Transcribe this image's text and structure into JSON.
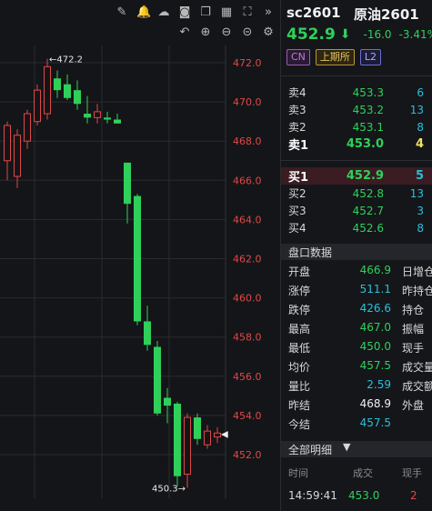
{
  "toolbar": {
    "row1": [
      {
        "name": "draw-pen-icon",
        "glyph": "✎"
      },
      {
        "name": "alert-bell-icon",
        "glyph": "🔔"
      },
      {
        "name": "cloud-icon",
        "glyph": "☁"
      },
      {
        "name": "camera-icon",
        "glyph": "◙"
      },
      {
        "name": "window-icon",
        "glyph": "❐"
      },
      {
        "name": "layout-icon",
        "glyph": "▦"
      },
      {
        "name": "fullscreen-icon",
        "glyph": "⛶"
      },
      {
        "name": "collapse-icon",
        "glyph": "»"
      }
    ],
    "row2": [
      {
        "name": "undo-icon",
        "glyph": "↶"
      },
      {
        "name": "zoom-in-icon",
        "glyph": "⊕"
      },
      {
        "name": "zoom-out-icon",
        "glyph": "⊖"
      },
      {
        "name": "reset-icon",
        "glyph": "⊝"
      },
      {
        "name": "settings-gear-icon",
        "glyph": "⚙"
      }
    ]
  },
  "chart_data": {
    "type": "candlestick",
    "y_ticks": [
      "472.0",
      "470.0",
      "468.0",
      "466.0",
      "464.0",
      "462.0",
      "460.0",
      "458.0",
      "456.0",
      "454.0",
      "452.0"
    ],
    "ylim": [
      451.0,
      472.5
    ],
    "high_label": "←472.2",
    "low_label": "450.3→",
    "current_marker": "◀",
    "candles": [
      {
        "o": 467.0,
        "h": 469.0,
        "l": 466.0,
        "c": 468.8
      },
      {
        "o": 466.2,
        "h": 468.6,
        "l": 465.6,
        "c": 468.3
      },
      {
        "o": 468.0,
        "h": 469.6,
        "l": 467.6,
        "c": 469.4
      },
      {
        "o": 469.0,
        "h": 470.9,
        "l": 468.8,
        "c": 470.6
      },
      {
        "o": 469.4,
        "h": 472.2,
        "l": 469.1,
        "c": 471.8
      },
      {
        "o": 471.2,
        "h": 471.6,
        "l": 470.2,
        "c": 470.6
      },
      {
        "o": 470.9,
        "h": 471.4,
        "l": 470.1,
        "c": 470.2
      },
      {
        "o": 470.6,
        "h": 471.1,
        "l": 469.6,
        "c": 469.9
      },
      {
        "o": 469.4,
        "h": 470.3,
        "l": 468.9,
        "c": 469.2
      },
      {
        "o": 469.2,
        "h": 469.9,
        "l": 468.9,
        "c": 469.5
      },
      {
        "o": 469.2,
        "h": 469.5,
        "l": 468.9,
        "c": 469.1
      },
      {
        "o": 469.1,
        "h": 469.4,
        "l": 468.9,
        "c": 468.9
      },
      {
        "o": 466.9,
        "h": 466.9,
        "l": 463.8,
        "c": 464.8
      },
      {
        "o": 465.2,
        "h": 465.3,
        "l": 458.6,
        "c": 458.8
      },
      {
        "o": 458.8,
        "h": 459.6,
        "l": 457.3,
        "c": 457.6
      },
      {
        "o": 457.5,
        "h": 457.8,
        "l": 454.0,
        "c": 454.1
      },
      {
        "o": 454.9,
        "h": 455.4,
        "l": 453.6,
        "c": 454.5
      },
      {
        "o": 454.6,
        "h": 454.7,
        "l": 450.4,
        "c": 450.9
      },
      {
        "o": 451.0,
        "h": 454.1,
        "l": 450.3,
        "c": 453.9
      },
      {
        "o": 453.9,
        "h": 454.1,
        "l": 452.5,
        "c": 452.8
      },
      {
        "o": 452.5,
        "h": 453.5,
        "l": 452.3,
        "c": 453.2
      },
      {
        "o": 452.9,
        "h": 453.4,
        "l": 452.6,
        "c": 453.1
      }
    ]
  },
  "quote": {
    "symbol": "sc2601",
    "name": "原油2601",
    "last": "452.9",
    "arrow": "⬇",
    "change": "-16.0",
    "change_pct": "-3.41%",
    "tags": [
      "CN",
      "上期所",
      "L2"
    ]
  },
  "asks": [
    {
      "label": "卖4",
      "price": "453.3",
      "vol": "6"
    },
    {
      "label": "卖3",
      "price": "453.2",
      "vol": "13"
    },
    {
      "label": "卖2",
      "price": "453.1",
      "vol": "8"
    },
    {
      "label": "卖1",
      "price": "453.0",
      "vol": "4"
    }
  ],
  "bids": [
    {
      "label": "买1",
      "price": "452.9",
      "vol": "5"
    },
    {
      "label": "买2",
      "price": "452.8",
      "vol": "13"
    },
    {
      "label": "买3",
      "price": "452.7",
      "vol": "3"
    },
    {
      "label": "买4",
      "price": "452.6",
      "vol": "8"
    }
  ],
  "panel_title": "盘口数据",
  "stats": [
    {
      "k": "开盘",
      "v": "466.9",
      "color": "#2fd05a",
      "k2": "日增仓"
    },
    {
      "k": "涨停",
      "v": "511.1",
      "color": "#29c0d8",
      "k2": "昨持仓"
    },
    {
      "k": "跌停",
      "v": "426.6",
      "color": "#29c0d8",
      "k2": "持仓"
    },
    {
      "k": "最高",
      "v": "467.0",
      "color": "#2fd05a",
      "k2": "振幅"
    },
    {
      "k": "最低",
      "v": "450.0",
      "color": "#2fd05a",
      "k2": "现手"
    },
    {
      "k": "均价",
      "v": "457.5",
      "color": "#2fd05a",
      "k2": "成交量"
    },
    {
      "k": "量比",
      "v": "2.59",
      "color": "#29c0d8",
      "k2": "成交额"
    },
    {
      "k": "昨结",
      "v": "468.9",
      "color": "#f0f0f0",
      "k2": "外盘"
    },
    {
      "k": "今结",
      "v": "457.5",
      "color": "#29c0d8",
      "k2": ""
    }
  ],
  "detail": {
    "title": "全部明细",
    "caret": "▼",
    "headers": {
      "time": "时间",
      "price": "成交",
      "qty": "现手"
    },
    "row": {
      "time": "14:59:41",
      "price": "453.0",
      "qty": "2"
    }
  },
  "colors": {
    "up": "#e04848",
    "down": "#2fd05a",
    "grid": "#2a2b30",
    "axis_text": "#e04848"
  }
}
